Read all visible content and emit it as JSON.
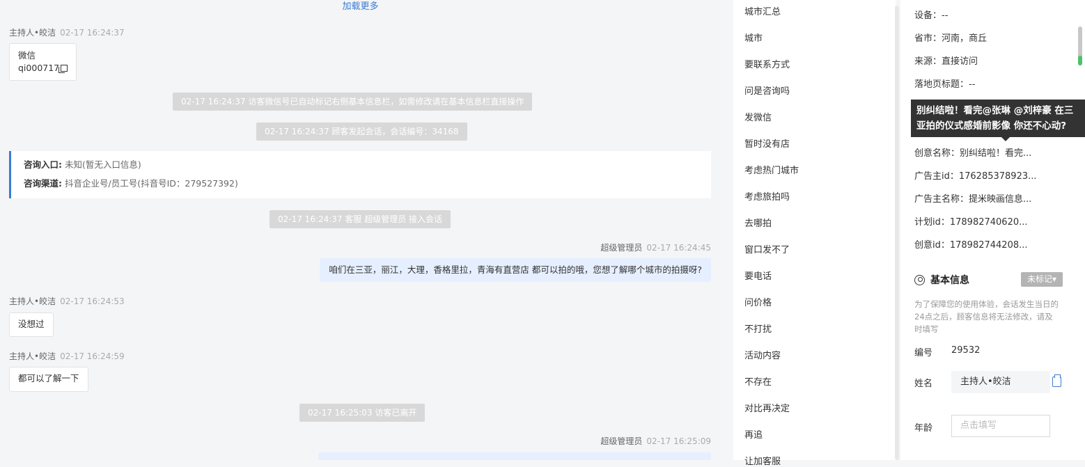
{
  "chat": {
    "load_more": "加载更多",
    "messages": [
      {
        "sender": "主持人•皎洁",
        "time": "02-17 16:24:37",
        "line1": "微信",
        "line2": "qi000717"
      },
      {
        "sys": "02-17 16:24:37 访客微信号已自动标记右侧基本信息栏，如需修改请在基本信息栏直接操作"
      },
      {
        "sys": "02-17 16:24:37 顾客发起会话，会话编号：34168"
      },
      {
        "sys": "02-17 16:24:37 客服 超级管理员 接入会话"
      },
      {
        "sender": "超级管理员",
        "time": "02-17 16:24:45",
        "text": "咱们在三亚，丽江，大理，香格里拉，青海有直营店 都可以拍的哦，您想了解哪个城市的拍摄呀?"
      },
      {
        "sender": "主持人•皎洁",
        "time": "02-17 16:24:53",
        "text": "没想过"
      },
      {
        "sender": "主持人•皎洁",
        "time": "02-17 16:24:59",
        "text": "都可以了解一下"
      },
      {
        "sys": "02-17 16:25:03 访客已离开"
      },
      {
        "sender": "超级管理员",
        "time": "02-17 16:25:09"
      }
    ],
    "info_card": {
      "entry_label": "咨询入口:",
      "entry_value": "未知(暂无入口信息)",
      "channel_label": "咨询渠道:",
      "channel_value": "抖音企业号/员工号(抖音号ID：279527392)"
    }
  },
  "quick_replies": [
    "城市汇总",
    "城市",
    "要联系方式",
    "问是咨询吗",
    "发微信",
    "暂时没有店",
    "考虑热门城市",
    "考虑旅拍吗",
    "去哪拍",
    "窗口发不了",
    "要电话",
    "问价格",
    "不打扰",
    "活动内容",
    "不存在",
    "对比再决定",
    "再追",
    "让加客服"
  ],
  "panel": {
    "device": "设备：--",
    "province_city": "省市：河南，商丘",
    "source": "来源：直接访问",
    "landing_title": "落地页标题：--",
    "creative_name": "创意名称：别纠结啦！看完...",
    "advertiser_id": "广告主id：176285378923...",
    "advertiser_name": "广告主名称：提米映画信息...",
    "plan_id": "计划id：178982740620...",
    "creative_id": "创意id：178982744208...",
    "tooltip": "别纠结啦！看完@张琳 @刘梓豪 在三亚拍的仪式感婚前影像 你还不心动?",
    "basic_info_title": "基本信息",
    "tag_button": "未标记▾",
    "note": "为了保障您的使用体验，会话发生当日的24点之后，顾客信息将无法修改，请及时填写",
    "id_label": "编号",
    "id_value": "29532",
    "name_label": "姓名",
    "name_value": "主持人•皎洁",
    "age_label": "年龄",
    "age_placeholder": "点击填写"
  }
}
